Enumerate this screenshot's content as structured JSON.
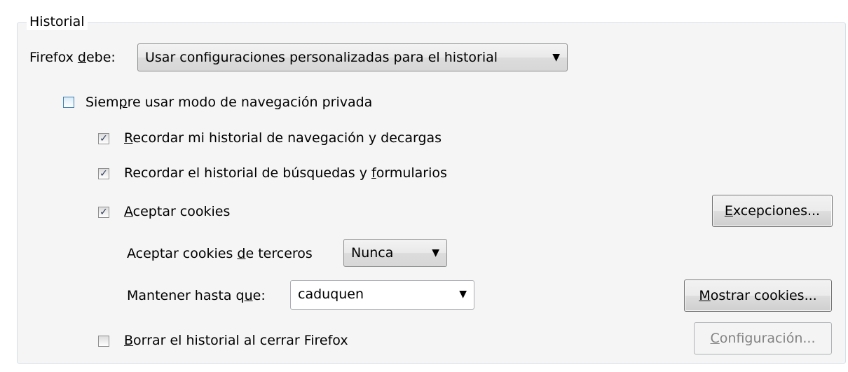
{
  "history": {
    "group_title": "Historial",
    "firefox_will": {
      "label_pre": "Firefox ",
      "label_underline": "d",
      "label_post": "ebe:",
      "value": "Usar configuraciones personalizadas para el historial"
    },
    "private_mode": {
      "label_pre": "Siem",
      "label_underline": "p",
      "label_post": "re usar modo de navegación privada",
      "checked": false
    },
    "remember_browsing": {
      "label_pre": "",
      "label_underline": "R",
      "label_post": "ecordar mi historial de navegación y decargas",
      "checked": true
    },
    "remember_search": {
      "label_pre": "Recordar el historial de búsquedas y ",
      "label_underline": "f",
      "label_post": "ormularios",
      "checked": true
    },
    "accept_cookies": {
      "label_pre": "",
      "label_underline": "A",
      "label_post": "ceptar cookies",
      "checked": true
    },
    "exceptions_button": {
      "label_underline": "E",
      "label_post": "xcepciones..."
    },
    "third_party": {
      "label_pre": "Aceptar cookies ",
      "label_underline": "d",
      "label_post": "e terceros",
      "value": "Nunca"
    },
    "keep_until": {
      "label_pre": "Mantener hasta q",
      "label_underline": "u",
      "label_post": "e:",
      "value": "caduquen"
    },
    "show_cookies_button": {
      "label_underline": "M",
      "label_post": "ostrar cookies..."
    },
    "clear_on_close": {
      "label_pre": "",
      "label_underline": "B",
      "label_post": "orrar el historial al cerrar Firefox",
      "checked": false
    },
    "settings_button": {
      "label_underline": "C",
      "label_post": "onfiguración..."
    },
    "dropdown_arrow": "▼",
    "check_mark": "✓"
  }
}
